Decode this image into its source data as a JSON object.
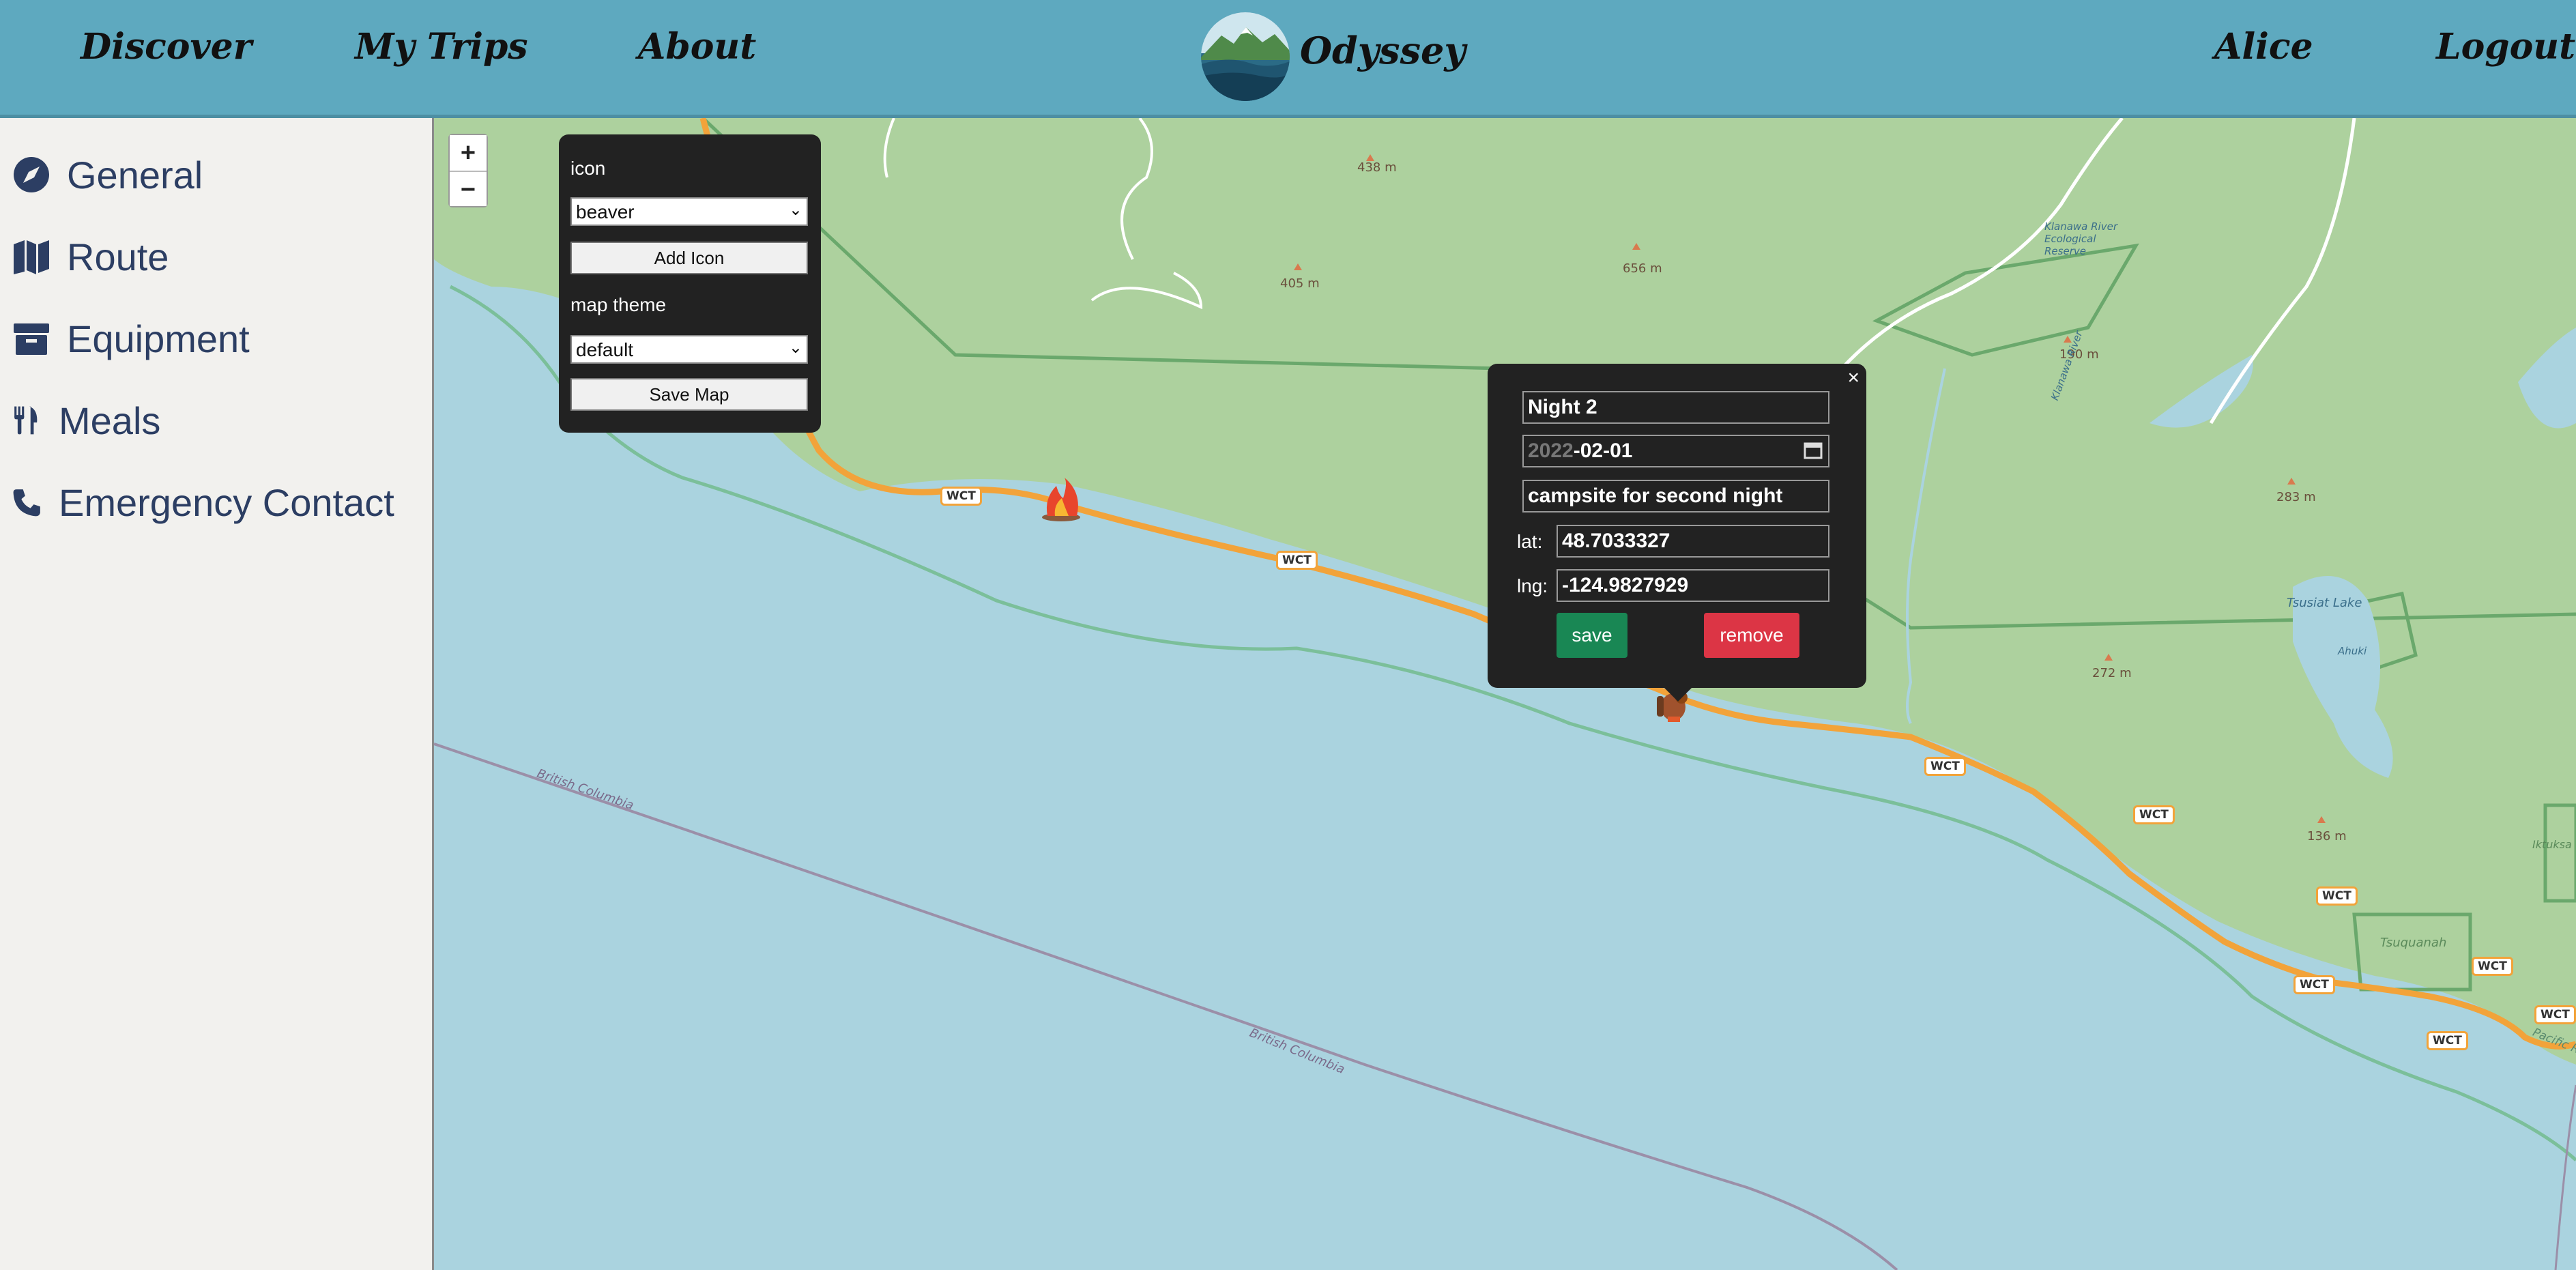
{
  "header": {
    "nav": [
      "Discover",
      "My Trips",
      "About"
    ],
    "brand": "Odyssey",
    "user": "Alice",
    "logout": "Logout"
  },
  "sidebar": {
    "items": [
      {
        "label": "General",
        "icon": "compass-icon"
      },
      {
        "label": "Route",
        "icon": "map-icon"
      },
      {
        "label": "Equipment",
        "icon": "archive-icon"
      },
      {
        "label": "Meals",
        "icon": "utensils-icon"
      },
      {
        "label": "Emergency Contact",
        "icon": "phone-icon"
      }
    ]
  },
  "map": {
    "zoom_in": "+",
    "zoom_out": "−",
    "trail_badge": "WCT",
    "peaks": [
      "438 m",
      "656 m",
      "405 m",
      "190 m",
      "283 m",
      "272 m",
      "136 m"
    ],
    "lakes": [
      "Tsusiat Lake",
      "Ahuki",
      "Tsuquanah",
      "Klanawa River"
    ],
    "reserve": "Klanawa River Ecological Reserve",
    "kiana_river": "Klanawa River",
    "boundary": "British Columbia",
    "park": "Pacific Rim National Park Reserve - West Coast Trail Unit",
    "edge_label": "Iktuksa",
    "colors": {
      "land": "#add19e",
      "water": "#aad3df",
      "trail": "#f2a33a",
      "boundary": "#9b8fa8"
    }
  },
  "panel": {
    "icon_label": "icon",
    "icon_value": "beaver",
    "add_icon": "Add Icon",
    "theme_label": "map theme",
    "theme_value": "default",
    "save_map": "Save Map"
  },
  "popup": {
    "close": "×",
    "title": "Night 2",
    "date_year": "2022",
    "date_rest": "-02-01",
    "description": "campsite for second night",
    "lat_label": "lat:",
    "lat": "48.7033327",
    "lng_label": "lng:",
    "lng": "-124.9827929",
    "save": "save",
    "remove": "remove",
    "save_color": "#198754",
    "remove_color": "#dc3545"
  }
}
